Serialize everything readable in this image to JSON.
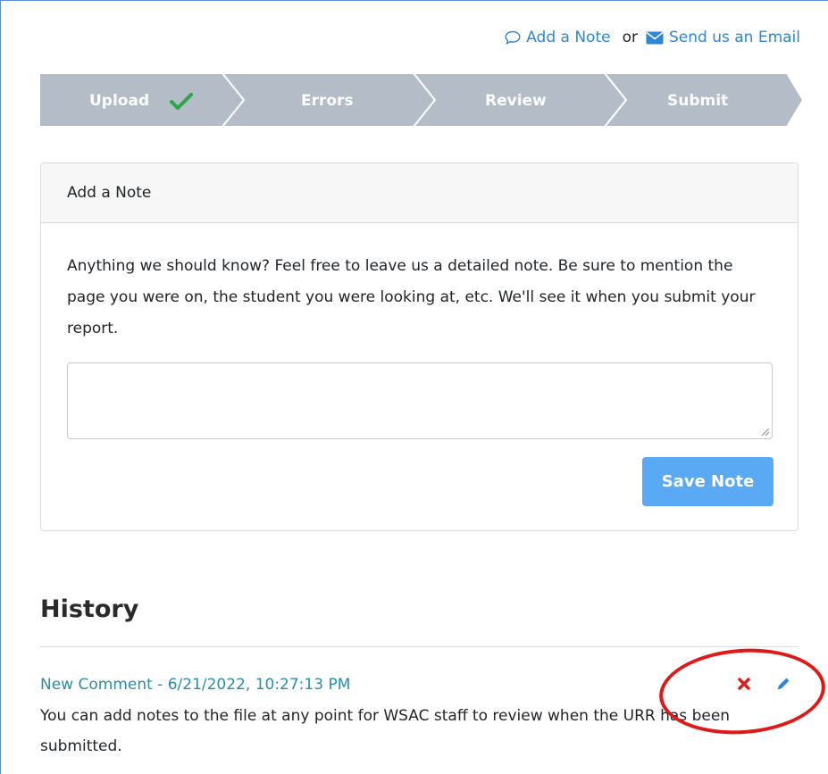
{
  "header_links": {
    "add_note": "Add a Note",
    "or": "or",
    "email": "Send us an Email"
  },
  "wizard": {
    "steps": [
      {
        "label": "Upload",
        "completed": true
      },
      {
        "label": "Errors",
        "completed": false
      },
      {
        "label": "Review",
        "completed": false
      },
      {
        "label": "Submit",
        "completed": false
      }
    ],
    "colors": {
      "step_bg": "#b3bcc7",
      "check": "#28a745"
    }
  },
  "note_card": {
    "title": "Add a Note",
    "description": "Anything we should know? Feel free to leave us a detailed note. Be sure to mention the page you were on, the student you were looking at, etc. We'll see it when you submit your report.",
    "textarea_value": "",
    "save_label": "Save Note"
  },
  "history": {
    "title": "History",
    "items": [
      {
        "header": "New Comment - 6/21/2022, 10:27:13 PM",
        "body": "You can add notes to the file at any point for WSAC staff to review when the URR has been submitted.",
        "actions": [
          "delete-icon",
          "pencil-icon"
        ]
      }
    ]
  },
  "colors": {
    "link": "#2f86d6",
    "primary_button": "#5aa9f4",
    "comment_header": "#2a8ea6",
    "delete": "#e01818",
    "highlight": "#e01818"
  }
}
